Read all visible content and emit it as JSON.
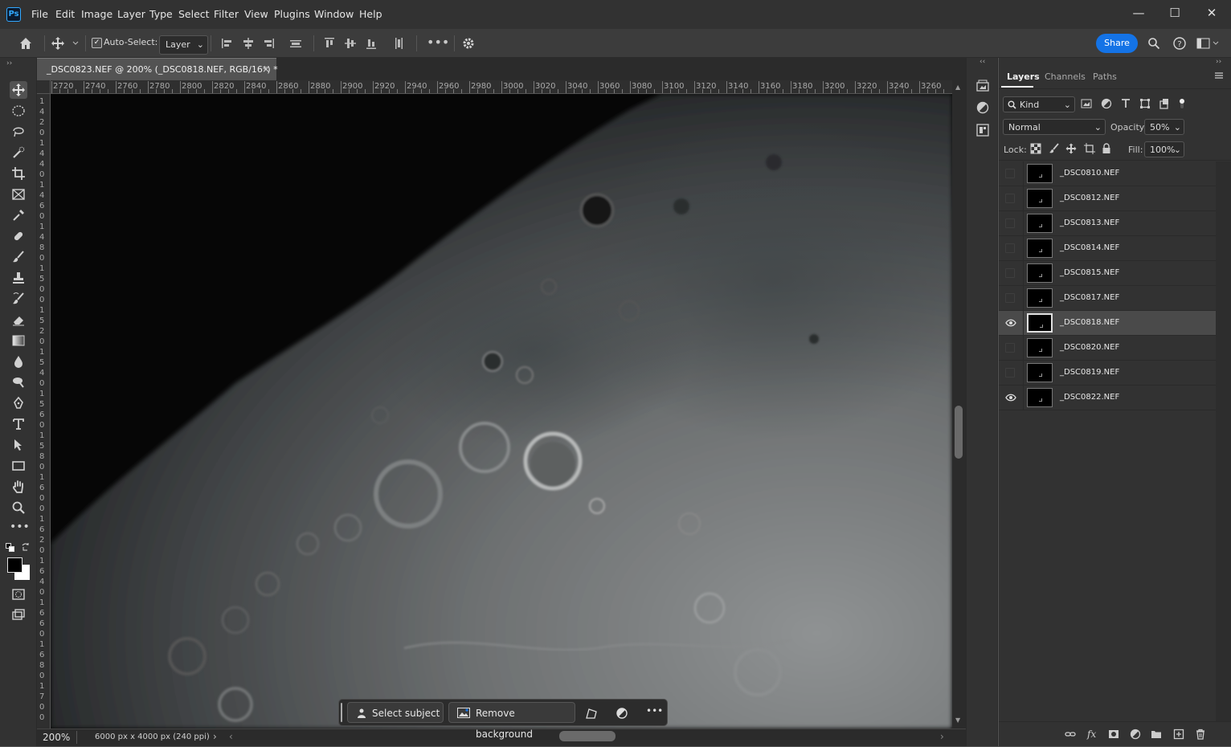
{
  "app": {
    "logo_text": "Ps"
  },
  "menu": [
    "File",
    "Edit",
    "Image",
    "Layer",
    "Type",
    "Select",
    "Filter",
    "View",
    "Plugins",
    "Window",
    "Help"
  ],
  "window_controls": [
    "—",
    "☐",
    "✕"
  ],
  "options_bar": {
    "auto_select_label": "Auto-Select:",
    "auto_select_checked": true,
    "auto_select_target": "Layer",
    "share_label": "Share"
  },
  "document": {
    "tab_title": "_DSC0823.NEF @ 200% (_DSC0818.NEF, RGB/16*) *",
    "zoom": "200%",
    "info": "6000 px x 4000 px (240 ppi)"
  },
  "ruler_h": [
    "2720",
    "2740",
    "2760",
    "2780",
    "2800",
    "2820",
    "2840",
    "2860",
    "2880",
    "2900",
    "2920",
    "2940",
    "2960",
    "2980",
    "3000",
    "3020",
    "3040",
    "3060",
    "3080",
    "3100",
    "3120",
    "3140",
    "3160",
    "3180",
    "3200",
    "3220",
    "3240",
    "3260"
  ],
  "ruler_v": [
    "1",
    "4",
    "2",
    "0",
    "1",
    "4",
    "4",
    "0",
    "1",
    "4",
    "6",
    "0",
    "1",
    "4",
    "8",
    "0",
    "1",
    "5",
    "0",
    "0",
    "1",
    "5",
    "2",
    "0",
    "1",
    "5",
    "4",
    "0",
    "1",
    "5",
    "6",
    "0",
    "1",
    "5",
    "8",
    "0",
    "1",
    "6",
    "0",
    "0",
    "1",
    "6",
    "2",
    "0",
    "1",
    "6",
    "4",
    "0",
    "1",
    "6",
    "6",
    "0",
    "1",
    "6",
    "8",
    "0",
    "1",
    "7",
    "0",
    "0"
  ],
  "taskbar": {
    "select_subject": "Select subject",
    "remove_background": "Remove background",
    "more": "•••"
  },
  "panels": {
    "tabs": [
      "Layers",
      "Channels",
      "Paths"
    ],
    "filter_kind": "Kind",
    "blend_mode": "Normal",
    "opacity_label": "Opacity:",
    "opacity_value": "50%",
    "lock_label": "Lock:",
    "fill_label": "Fill:",
    "fill_value": "100%"
  },
  "layers": [
    {
      "name": "_DSC0810.NEF",
      "visible": false,
      "selected": false
    },
    {
      "name": "_DSC0812.NEF",
      "visible": false,
      "selected": false
    },
    {
      "name": "_DSC0813.NEF",
      "visible": false,
      "selected": false
    },
    {
      "name": "_DSC0814.NEF",
      "visible": false,
      "selected": false
    },
    {
      "name": "_DSC0815.NEF",
      "visible": false,
      "selected": false
    },
    {
      "name": "_DSC0817.NEF",
      "visible": false,
      "selected": false
    },
    {
      "name": "_DSC0818.NEF",
      "visible": true,
      "selected": true
    },
    {
      "name": "_DSC0820.NEF",
      "visible": false,
      "selected": false
    },
    {
      "name": "_DSC0819.NEF",
      "visible": false,
      "selected": false
    },
    {
      "name": "_DSC0822.NEF",
      "visible": true,
      "selected": false
    }
  ],
  "colors": {
    "accent": "#1473e6",
    "panel_bg": "#323232",
    "canvas_dark": "#060606"
  },
  "icons": {
    "toolbar": [
      "move-icon",
      "marquee-icon",
      "lasso-icon",
      "quick-select-icon",
      "crop-icon",
      "frame-icon",
      "eyedropper-icon",
      "healing-brush-icon",
      "brush-icon",
      "clone-stamp-icon",
      "history-brush-icon",
      "eraser-icon",
      "gradient-icon",
      "blur-icon",
      "dodge-icon",
      "pen-icon",
      "type-icon",
      "path-select-icon",
      "rectangle-icon",
      "hand-icon",
      "zoom-icon",
      "more-tools-icon"
    ]
  }
}
